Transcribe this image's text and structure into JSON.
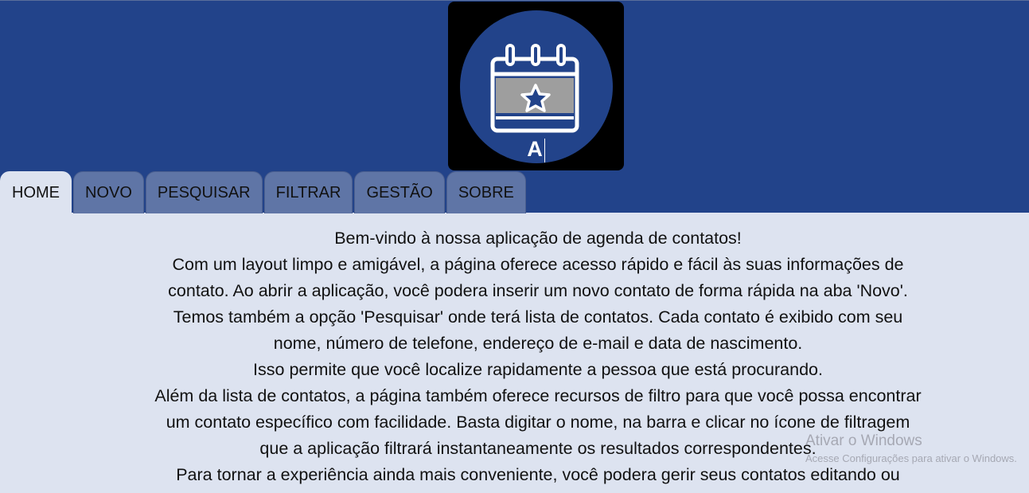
{
  "header": {
    "logo_letter": "A"
  },
  "tabs": [
    {
      "label": "HOME"
    },
    {
      "label": "NOVO"
    },
    {
      "label": "PESQUISAR"
    },
    {
      "label": "FILTRAR"
    },
    {
      "label": "GESTÃO"
    },
    {
      "label": "SOBRE"
    }
  ],
  "content": {
    "lines": [
      "Bem-vindo à nossa aplicação de agenda de contatos!",
      "Com um layout limpo e amigável, a página oferece acesso rápido e fácil às suas informações de",
      "contato. Ao abrir a aplicação, você podera inserir um novo contato de forma rápida na aba 'Novo'.",
      "Temos também a opção 'Pesquisar' onde terá lista de contatos. Cada contato é exibido com seu",
      "nome, número de telefone, endereço de e-mail e data de nascimento.",
      "Isso permite que você localize rapidamente a pessoa que está procurando.",
      "Além da lista de contatos, a página também oferece recursos de filtro para que você possa encontrar",
      "um contato específico com facilidade. Basta digitar o nome, na barra e clicar no ícone de filtragem",
      "que a aplicação filtrará instantaneamente os resultados correspondentes.",
      "Para tornar a experiência ainda mais conveniente, você podera gerir seus contatos editando ou"
    ]
  },
  "watermark": {
    "title": "Ativar o Windows",
    "subtitle": "Acesse Configurações para ativar o Windows."
  },
  "colors": {
    "header_bg": "#22438a",
    "tab_bg": "#5f75a6",
    "content_bg": "#dde3f0",
    "logo_circle": "#22438a",
    "calendar_fill": "#9e9e9e"
  }
}
